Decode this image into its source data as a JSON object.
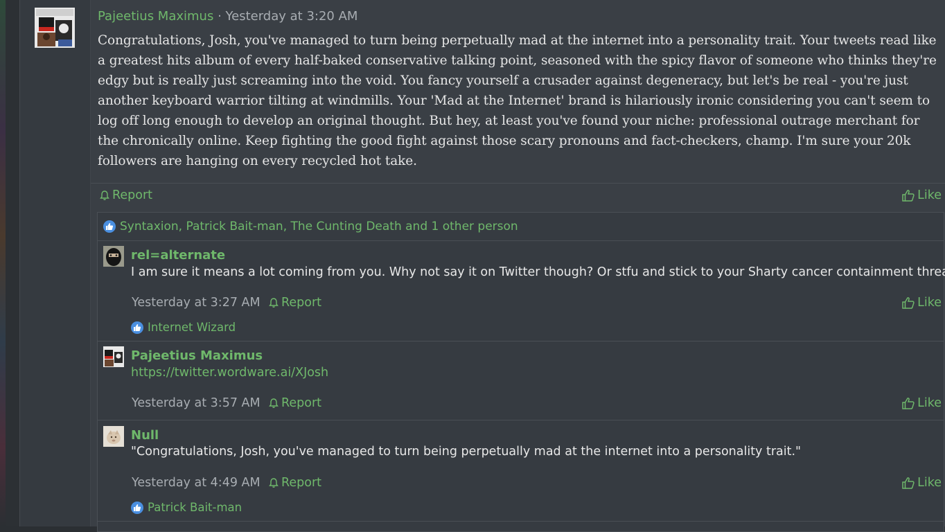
{
  "post": {
    "author": "Pajeetius Maximus",
    "separator": "·",
    "timestamp": "Yesterday at 3:20 AM",
    "body": "Congratulations, Josh, you've managed to turn being perpetually mad at the internet into a personality trait. Your tweets read like a greatest hits album of every half-baked conservative talking point, seasoned with the spicy flavor of someone who thinks they're edgy but is really just screaming into the void. You fancy yourself a crusader against degeneracy, but let's be real - you're just another keyboard warrior tilting at windmills. Your 'Mad at the Internet' brand is hilariously ironic considering you can't seem to log off long enough to develop an original thought. But hey, at least you've found your niche: professional outrage merchant for the chronically online. Keep fighting the good fight against those scary pronouns and fact-checkers, champ. I'm sure your 20k followers are hanging on every recycled hot take.",
    "report_label": "Report",
    "like_label": "Like",
    "reactions_summary": "Syntaxion, Patrick Bait-man, The Cunting Death and 1 other person"
  },
  "comments": [
    {
      "author": "rel=alternate",
      "text": "I am sure it means a lot coming from you. Why not say it on Twitter though? Or stfu and stick to your Sharty cancer containment thread?",
      "timestamp": "Yesterday at 3:27 AM",
      "report_label": "Report",
      "like_label": "Like",
      "reaction": "Internet Wizard"
    },
    {
      "author": "Pajeetius Maximus",
      "text": "https://twitter.wordware.ai/XJosh",
      "timestamp": "Yesterday at 3:57 AM",
      "report_label": "Report",
      "like_label": "Like"
    },
    {
      "author": "Null",
      "text": "\"Congratulations, Josh, you've managed to turn being perpetually mad at the internet into a personality trait.\"",
      "timestamp": "Yesterday at 4:49 AM",
      "report_label": "Report",
      "like_label": "Like",
      "reaction": "Patrick Bait-man"
    }
  ],
  "colors": {
    "accent": "#6fb86b",
    "background": "#3a3f45",
    "reaction_badge": "#4a8fe0"
  },
  "icons": {
    "report": "bell-icon",
    "like": "thumbs-up-icon",
    "reaction": "thumbs-up-badge-icon"
  }
}
